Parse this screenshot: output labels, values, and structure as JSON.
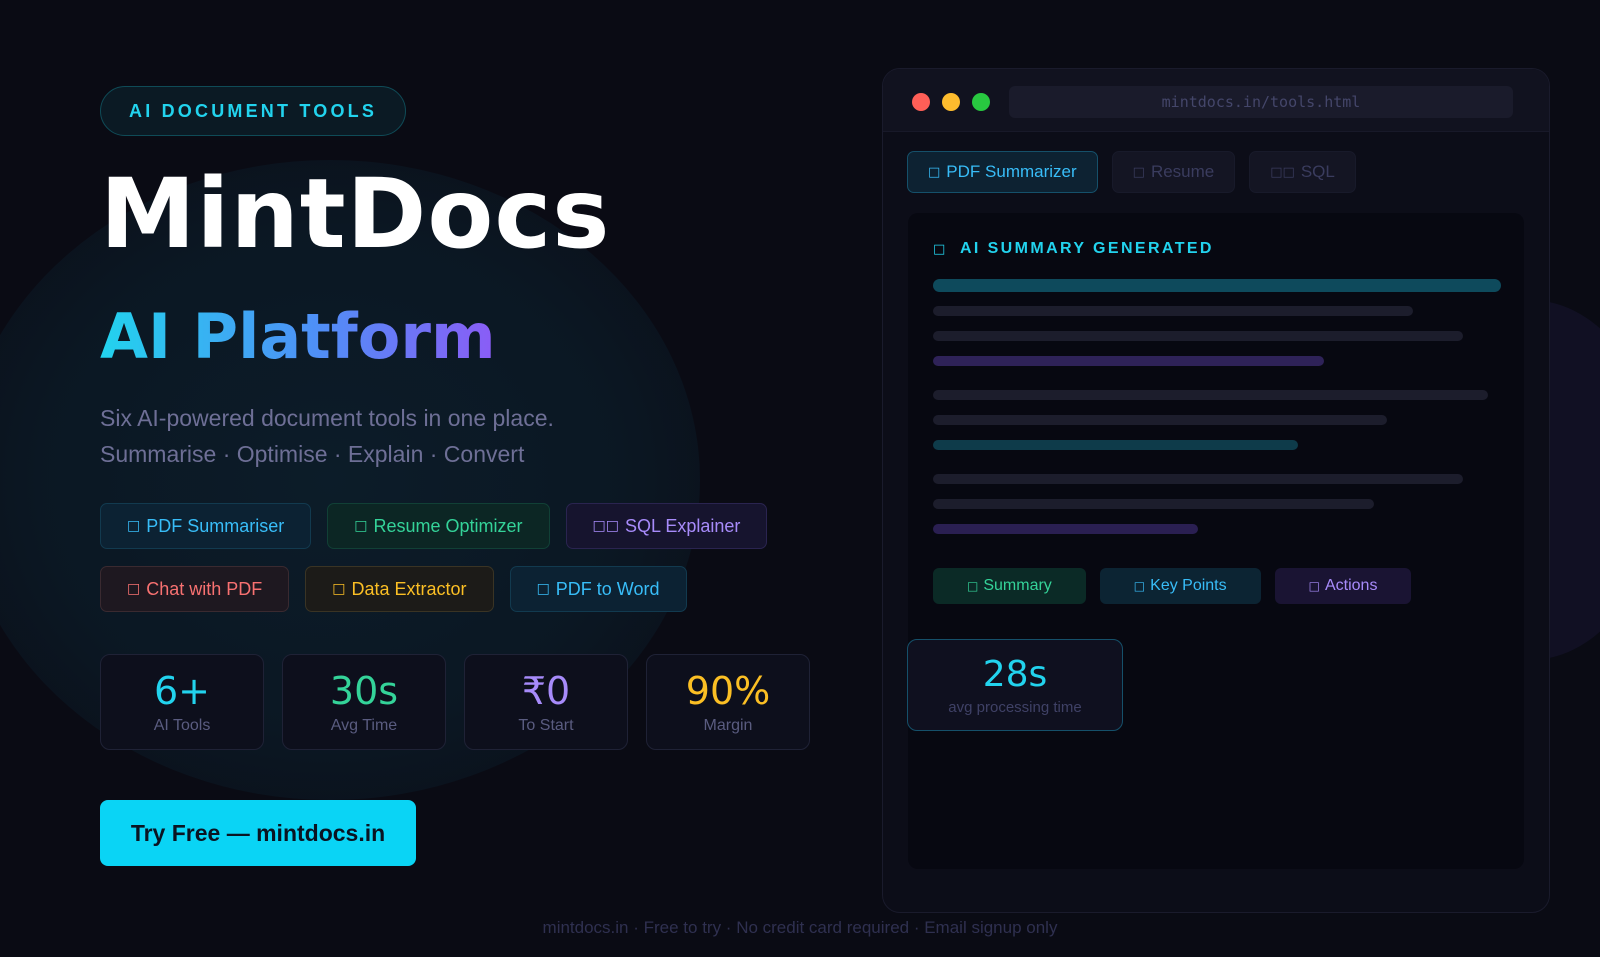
{
  "hero": {
    "eyebrow": "AI DOCUMENT TOOLS",
    "title": "MintDocs",
    "subtitle": "AI Platform",
    "description_line1": "Six AI-powered document tools in one place.",
    "description_line2": "Summarise · Optimise · Explain · Convert"
  },
  "tools": [
    {
      "icon": "□",
      "label": "PDF Summariser",
      "color": "#38bdf8"
    },
    {
      "icon": "□",
      "label": "Resume Optimizer",
      "color": "#34d399"
    },
    {
      "icon": "□□",
      "label": "SQL Explainer",
      "color": "#a78bfa"
    },
    {
      "icon": "□",
      "label": "Chat with PDF",
      "color": "#f87171"
    },
    {
      "icon": "□",
      "label": "Data Extractor",
      "color": "#fbbf24"
    },
    {
      "icon": "□",
      "label": "PDF to Word",
      "color": "#38bdf8"
    }
  ],
  "stats": [
    {
      "value": "6+",
      "label": "AI Tools",
      "color": "#22d3ee"
    },
    {
      "value": "30s",
      "label": "Avg Time",
      "color": "#34d399"
    },
    {
      "value": "₹0",
      "label": "To Start",
      "color": "#a78bfa"
    },
    {
      "value": "90%",
      "label": "Margin",
      "color": "#fbbf24"
    }
  ],
  "cta": {
    "label": "Try Free — mintdocs.in"
  },
  "footer": "mintdocs.in · Free to try · No credit card required · Email signup only",
  "preview": {
    "url": "mintdocs.in/tools.html",
    "tabs": [
      {
        "icon": "□",
        "label": "PDF Summarizer",
        "active": true
      },
      {
        "icon": "□",
        "label": "Resume",
        "active": false
      },
      {
        "icon": "□□",
        "label": "SQL",
        "active": false
      }
    ],
    "panel_title": "AI SUMMARY GENERATED",
    "panel_icon": "□",
    "output_tags": [
      {
        "icon": "□",
        "label": "Summary"
      },
      {
        "icon": "□",
        "label": "Key Points"
      },
      {
        "icon": "□",
        "label": "Actions"
      }
    ],
    "timer": {
      "value": "28s",
      "label": "avg processing time"
    }
  },
  "colors": {
    "background": "#0a0b14",
    "accent_cyan": "#22d3ee",
    "accent_purple": "#8b5cf6",
    "cta": "#0ad4f5"
  }
}
